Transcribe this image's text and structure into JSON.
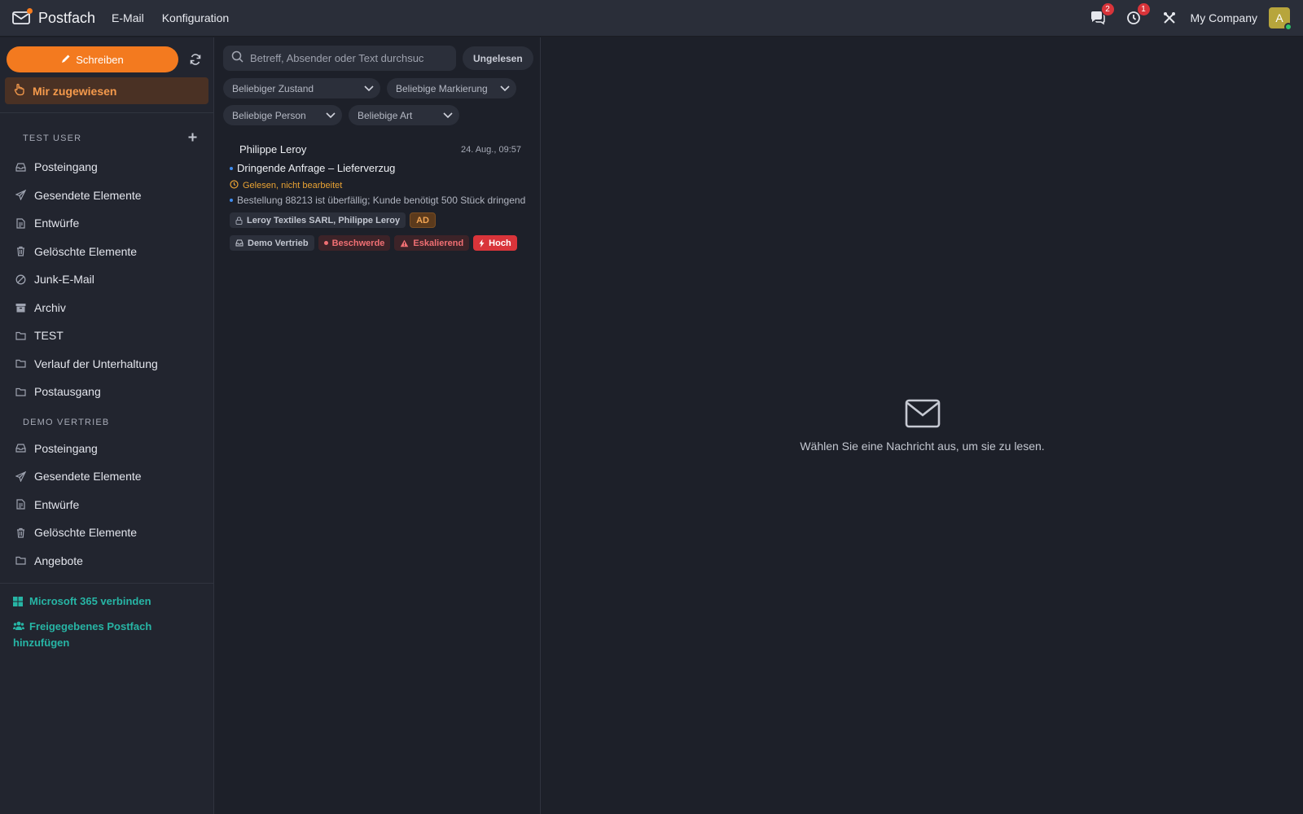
{
  "topbar": {
    "brand": "Postfach",
    "nav": [
      "E-Mail",
      "Konfiguration"
    ],
    "chat_badge": "2",
    "timer_badge": "1",
    "company": "My Company",
    "avatar_letter": "A",
    "icons": {
      "mail": "mail-icon",
      "chat": "chat-icon",
      "timer": "timer-icon",
      "tools": "tools-icon"
    }
  },
  "sidebar": {
    "compose_label": "Schreiben",
    "assigned_label": "Mir zugewiesen",
    "sections": [
      {
        "title": "TEST USER",
        "folders": [
          {
            "label": "Posteingang",
            "icon": "inbox-icon"
          },
          {
            "label": "Gesendete Elemente",
            "icon": "send-icon"
          },
          {
            "label": "Entwürfe",
            "icon": "draft-icon"
          },
          {
            "label": "Gelöschte Elemente",
            "icon": "trash-icon"
          },
          {
            "label": "Junk-E-Mail",
            "icon": "ban-icon"
          },
          {
            "label": "Archiv",
            "icon": "archive-icon"
          },
          {
            "label": "TEST",
            "icon": "folder-icon"
          },
          {
            "label": "Verlauf der Unterhaltung",
            "icon": "folder-icon"
          },
          {
            "label": "Postausgang",
            "icon": "folder-icon"
          }
        ]
      },
      {
        "title": "DEMO VERTRIEB",
        "folders": [
          {
            "label": "Posteingang",
            "icon": "inbox-icon"
          },
          {
            "label": "Gesendete Elemente",
            "icon": "send-icon"
          },
          {
            "label": "Entwürfe",
            "icon": "draft-icon"
          },
          {
            "label": "Gelöschte Elemente",
            "icon": "trash-icon"
          },
          {
            "label": "Angebote",
            "icon": "folder-icon"
          }
        ]
      }
    ],
    "links": {
      "ms365": "Microsoft 365 verbinden",
      "shared": "Freigegebenes Postfach hinzufügen"
    }
  },
  "list": {
    "search_placeholder": "Betreff, Absender oder Text durchsuc",
    "unread_label": "Ungelesen",
    "filters": [
      "Beliebiger Zustand",
      "Beliebige Markierung",
      "Beliebige Person",
      "Beliebige Art"
    ],
    "message": {
      "sender": "Philippe Leroy",
      "date": "24. Aug., 09:57",
      "subject": "Dringende Anfrage – Lieferverzug",
      "status": "Gelesen, nicht bearbeitet",
      "preview": "Bestellung 88213 ist überfällig; Kunde benötigt 500 Stück dringend",
      "contact": "Leroy Textiles SARL, Philippe Leroy",
      "assignee": "AD",
      "mailbox": "Demo Vertrieb",
      "tag": "Beschwerde",
      "sentiment": "Eskalierend",
      "priority": "Hoch"
    }
  },
  "reading": {
    "empty_text": "Wählen Sie eine Nachricht aus, um sie zu lesen."
  },
  "colors": {
    "accent": "#f37a1f",
    "teal_link": "#27b5a5",
    "badge_red": "#d9343a"
  }
}
